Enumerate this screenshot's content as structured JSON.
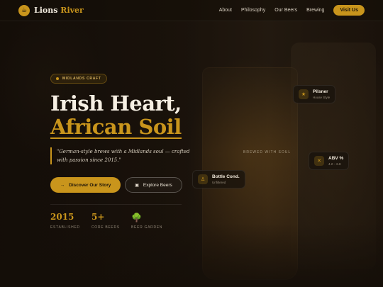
{
  "nav": {
    "brand_first": "Lions",
    "brand_second": "River",
    "links": [
      "About",
      "Philosophy",
      "Our Beers",
      "Brewing"
    ],
    "cta": "Visit Us"
  },
  "hero": {
    "badge": "MIDLANDS CRAFT",
    "title_line1": "Irish Heart,",
    "title_line2": "African Soil",
    "quote": "\"German-style brews with a Midlands soul — crafted with passion since 2015.\"",
    "primary_button": "Discover Our Story",
    "secondary_button": "Explore Beers"
  },
  "stats": [
    {
      "value": "2015",
      "label": "ESTABLISHED"
    },
    {
      "value": "5+",
      "label": "CORE BEERS"
    },
    {
      "value": "",
      "label": "BEER GARDEN",
      "icon": "tree-icon"
    }
  ],
  "side_label": "BREWED WITH SOUL",
  "cards": [
    {
      "title": "Pilsner",
      "subtitle": "House Style",
      "icon": "star-icon"
    },
    {
      "title": "ABV %",
      "subtitle": "4.2 – 6.8",
      "icon": "percent-icon"
    },
    {
      "title": "Bottle Cond.",
      "subtitle": "Unfiltered",
      "icon": "bottle-icon"
    }
  ],
  "colors": {
    "accent": "#c9951c",
    "background": "#1f160c"
  }
}
